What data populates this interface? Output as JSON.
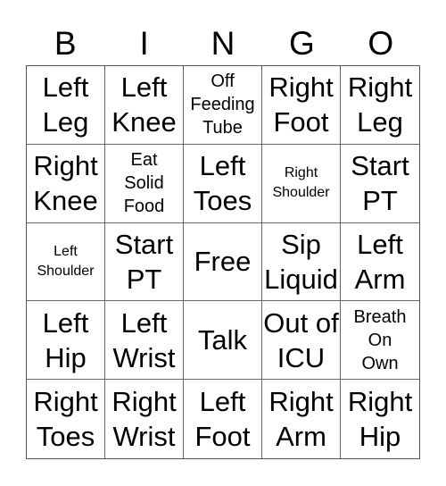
{
  "header": {
    "letters": [
      "B",
      "I",
      "N",
      "G",
      "O"
    ]
  },
  "cells": [
    {
      "text": "Left\nLeg",
      "size": "lg"
    },
    {
      "text": "Left\nKnee",
      "size": "lg"
    },
    {
      "text": "Off\nFeeding\nTube",
      "size": "md"
    },
    {
      "text": "Right\nFoot",
      "size": "lg"
    },
    {
      "text": "Right\nLeg",
      "size": "lg"
    },
    {
      "text": "Right\nKnee",
      "size": "lg"
    },
    {
      "text": "Eat\nSolid\nFood",
      "size": "md"
    },
    {
      "text": "Left\nToes",
      "size": "lg"
    },
    {
      "text": "Right\nShoulder",
      "size": "sm"
    },
    {
      "text": "Start\nPT",
      "size": "lg"
    },
    {
      "text": "Left\nShoulder",
      "size": "sm"
    },
    {
      "text": "Start\nPT",
      "size": "lg"
    },
    {
      "text": "Free",
      "size": "lg"
    },
    {
      "text": "Sip\nLiquid",
      "size": "lg"
    },
    {
      "text": "Left\nArm",
      "size": "lg"
    },
    {
      "text": "Left\nHip",
      "size": "lg"
    },
    {
      "text": "Left\nWrist",
      "size": "lg"
    },
    {
      "text": "Talk",
      "size": "lg"
    },
    {
      "text": "Out of\nICU",
      "size": "lg"
    },
    {
      "text": "Breath\nOn\nOwn",
      "size": "md"
    },
    {
      "text": "Right\nToes",
      "size": "lg"
    },
    {
      "text": "Right\nWrist",
      "size": "lg"
    },
    {
      "text": "Left\nFoot",
      "size": "lg"
    },
    {
      "text": "Right\nArm",
      "size": "lg"
    },
    {
      "text": "Right\nHip",
      "size": "lg"
    }
  ]
}
